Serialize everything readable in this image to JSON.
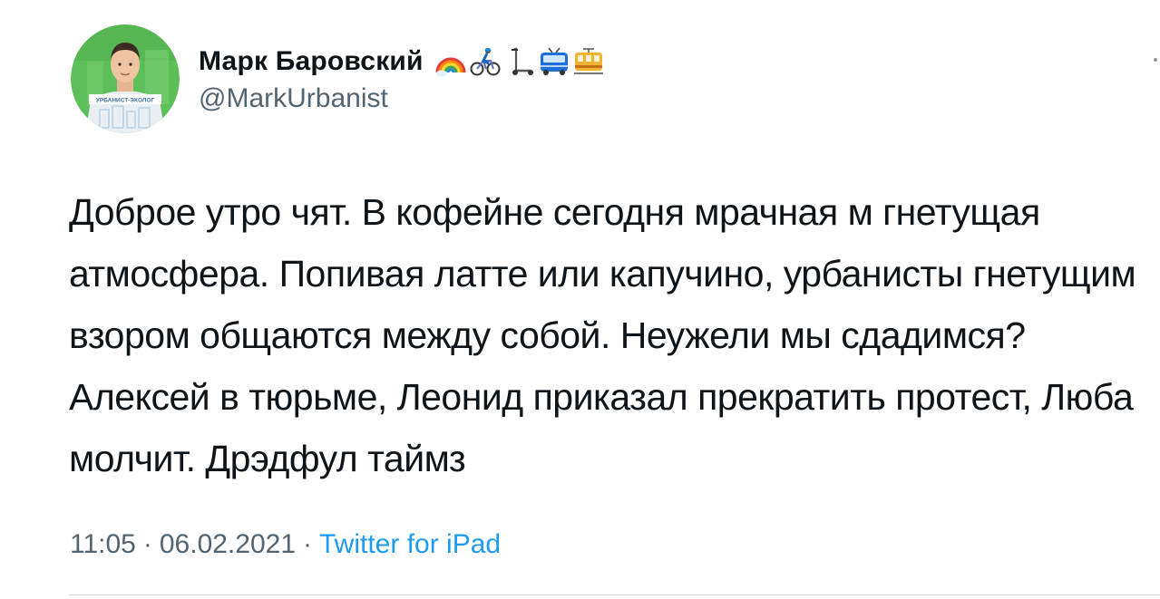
{
  "tweet": {
    "author": {
      "display_name": "Марк Баровский",
      "handle": "@MarkUrbanist",
      "avatar_caption": "УРБАНИСТ-ЭКОЛОГ",
      "name_emojis": [
        "rainbow-icon",
        "cyclist-icon",
        "scooter-icon",
        "bus-icon",
        "tram-icon"
      ]
    },
    "text": "Доброе утро чят. В кофейне сегодня мрачная м гнетущая атмосфера. Попивая латте или капучино, урбанисты гнетущим взором общаются между собой. Неужели мы сдадимся? Алексей в тюрьме, Леонид приказал прекратить протест, Люба молчит. Дрэдфул таймз",
    "time": "11:05",
    "date": "06.02.2021",
    "separator": "·",
    "source": "Twitter for iPad"
  },
  "colors": {
    "text": "#0f1419",
    "secondary": "#536471",
    "link": "#1d9bf0",
    "divider": "#cfd9de",
    "avatar_bg": "#5cbf58"
  }
}
